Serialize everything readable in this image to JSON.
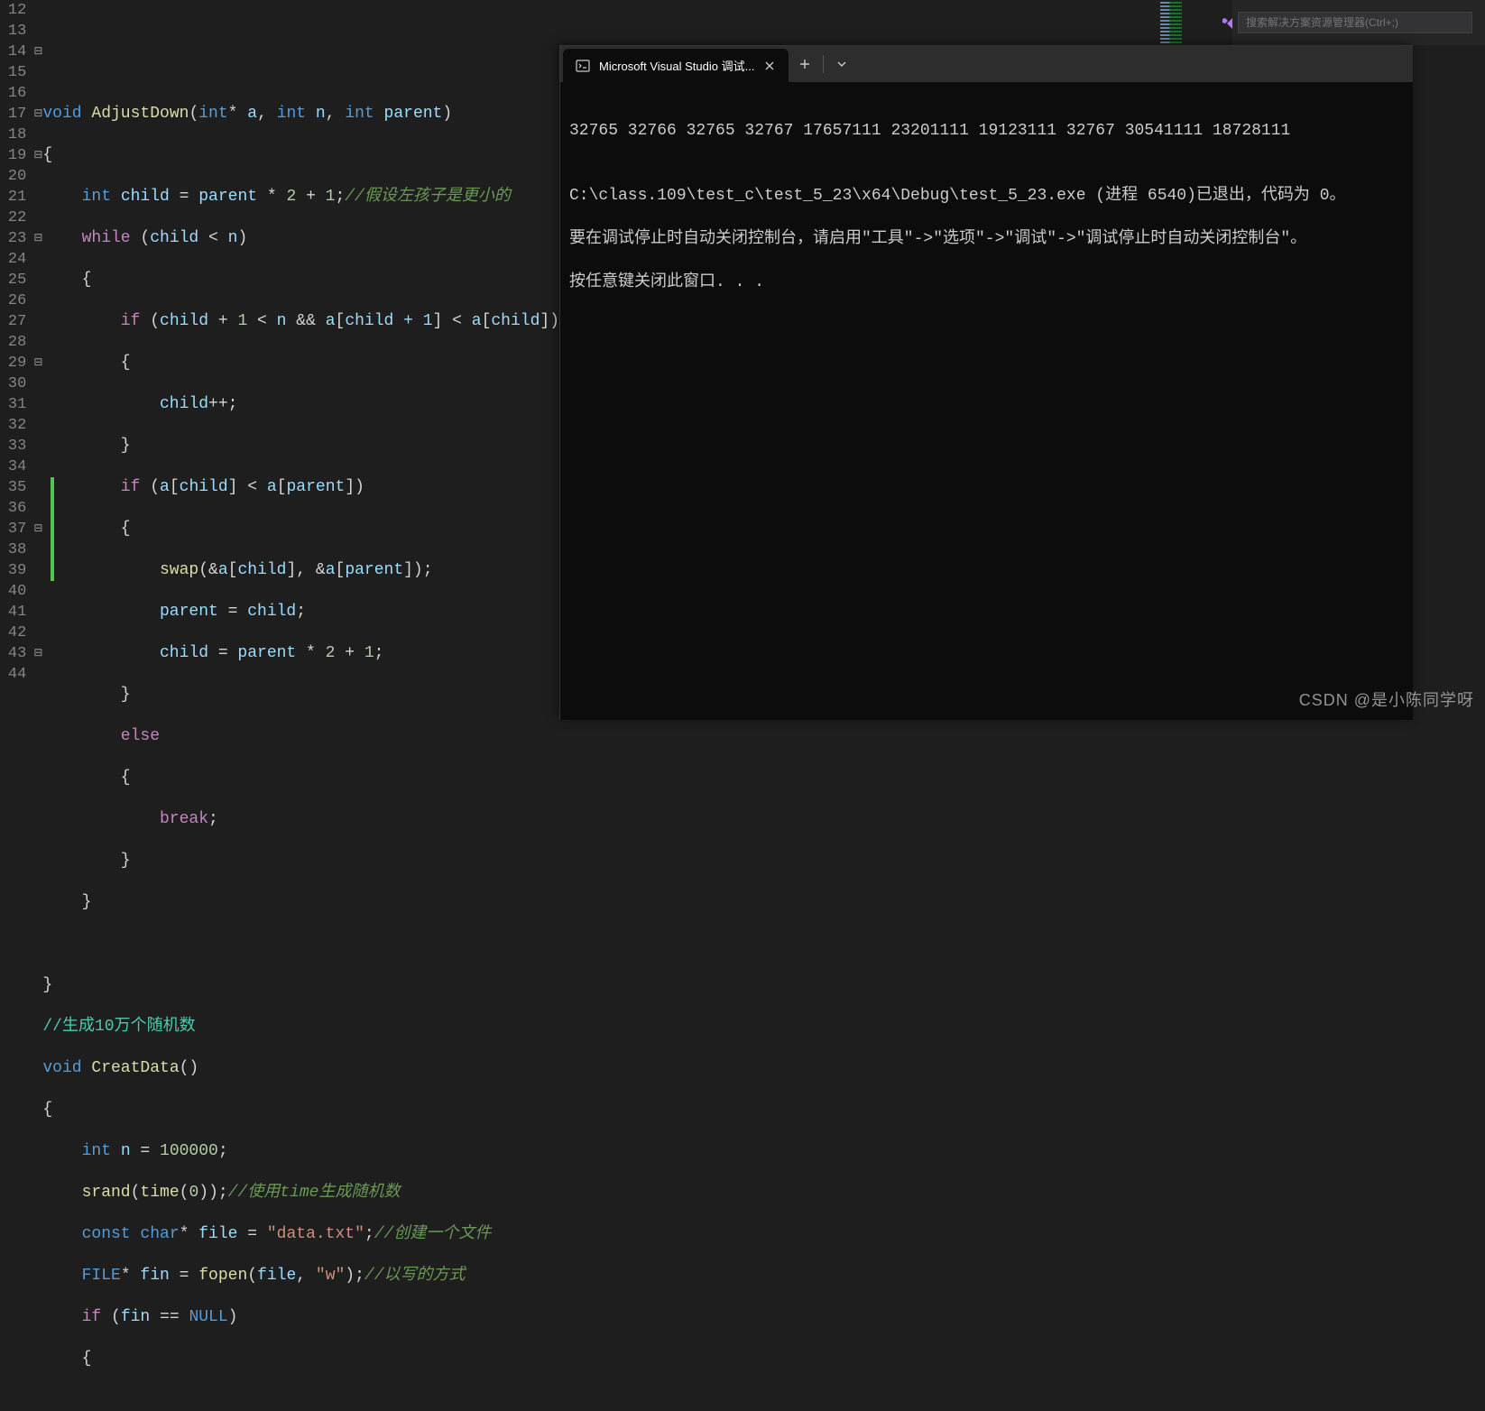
{
  "gutter": {
    "lines": [
      "12",
      "13",
      "14",
      "15",
      "16",
      "17",
      "18",
      "19",
      "20",
      "21",
      "22",
      "23",
      "24",
      "25",
      "26",
      "27",
      "28",
      "29",
      "30",
      "31",
      "32",
      "33",
      "34",
      "35",
      "36",
      "37",
      "38",
      "39",
      "40",
      "41",
      "42",
      "43",
      "44"
    ]
  },
  "folds": {
    "14": "⊟",
    "17": "⊟",
    "19": "⊟",
    "23": "⊟",
    "29": "⊟",
    "37": "⊟",
    "43": "⊟"
  },
  "code": {
    "l12": "",
    "l13": "",
    "l14": {
      "void": "void",
      "fn": "AdjustDown",
      "int": "int",
      "a": "a",
      "n": "n",
      "parent": "parent"
    },
    "l15": "{",
    "l16": {
      "int": "int",
      "child": "child",
      "eq": " = ",
      "parent": "parent",
      "mul": " * ",
      "two": "2",
      "plus": " + ",
      "one": "1",
      "semi": ";",
      "cm": "//假设左孩子是更小的"
    },
    "l17": {
      "while": "while",
      "child": "child",
      "lt": " < ",
      "n": "n"
    },
    "l18": "{",
    "l19": {
      "if": "if",
      "child": "child",
      "plus": " + ",
      "one": "1",
      "lt": " < ",
      "n": "n",
      "and": " && ",
      "a": "a",
      "childp1": "child + 1",
      "child2": "child"
    },
    "l20": "{",
    "l21": {
      "child": "child",
      "pp": "++;"
    },
    "l22": "}",
    "l23": {
      "if": "if",
      "a": "a",
      "child": "child",
      "lt": " < ",
      "parent": "parent"
    },
    "l24": "{",
    "l25": {
      "swap": "swap",
      "a": "a",
      "child": "child",
      "parent": "parent"
    },
    "l26": {
      "parent": "parent",
      "eq": " = ",
      "child": "child"
    },
    "l27": {
      "child": "child",
      "eq": " = ",
      "parent": "parent",
      "mul": " * ",
      "two": "2",
      "plus": " + ",
      "one": "1"
    },
    "l28": "}",
    "l29": {
      "else": "else"
    },
    "l30": "{",
    "l31": {
      "break": "break"
    },
    "l32": "}",
    "l33": "}",
    "l34": "",
    "l35": "}",
    "l36": {
      "cm": "//生成10万个随机数"
    },
    "l37": {
      "void": "void",
      "fn": "CreatData"
    },
    "l38": "{",
    "l39": {
      "int": "int",
      "n": "n",
      "eq": " = ",
      "val": "100000"
    },
    "l40": {
      "srand": "srand",
      "time": "time",
      "zero": "0",
      "cm": "//使用time生成随机数"
    },
    "l41": {
      "const": "const",
      "char": "char",
      "file": "file",
      "eq": " = ",
      "str": "\"data.txt\"",
      "cm": "//创建一个文件"
    },
    "l42": {
      "FILE": "FILE",
      "fin": "fin",
      "eq": " = ",
      "fopen": "fopen",
      "file": "file",
      "w": "\"w\"",
      "cm": "//以写的方式"
    },
    "l43": {
      "if": "if",
      "fin": "fin",
      "eqeq": " == ",
      "null": "NULL"
    },
    "l44": "{"
  },
  "terminal": {
    "tab_title": "Microsoft Visual Studio 调试...",
    "output_line1": "32765 32766 32765 32767 17657111 23201111 19123111 32767 30541111 18728111",
    "output_line2": "",
    "output_line3": "C:\\class.109\\test_c\\test_5_23\\x64\\Debug\\test_5_23.exe (进程 6540)已退出，代码为 0。",
    "output_line4": "要在调试停止时自动关闭控制台，请启用\"工具\"->\"选项\"->\"调试\"->\"调试停止时自动关闭控制台\"。",
    "output_line5": "按任意键关闭此窗口. . ."
  },
  "right_panel": {
    "search_placeholder": "搜索解决方案资源管理器(Ctrl+;)"
  },
  "watermark": "CSDN @是小陈同学呀"
}
